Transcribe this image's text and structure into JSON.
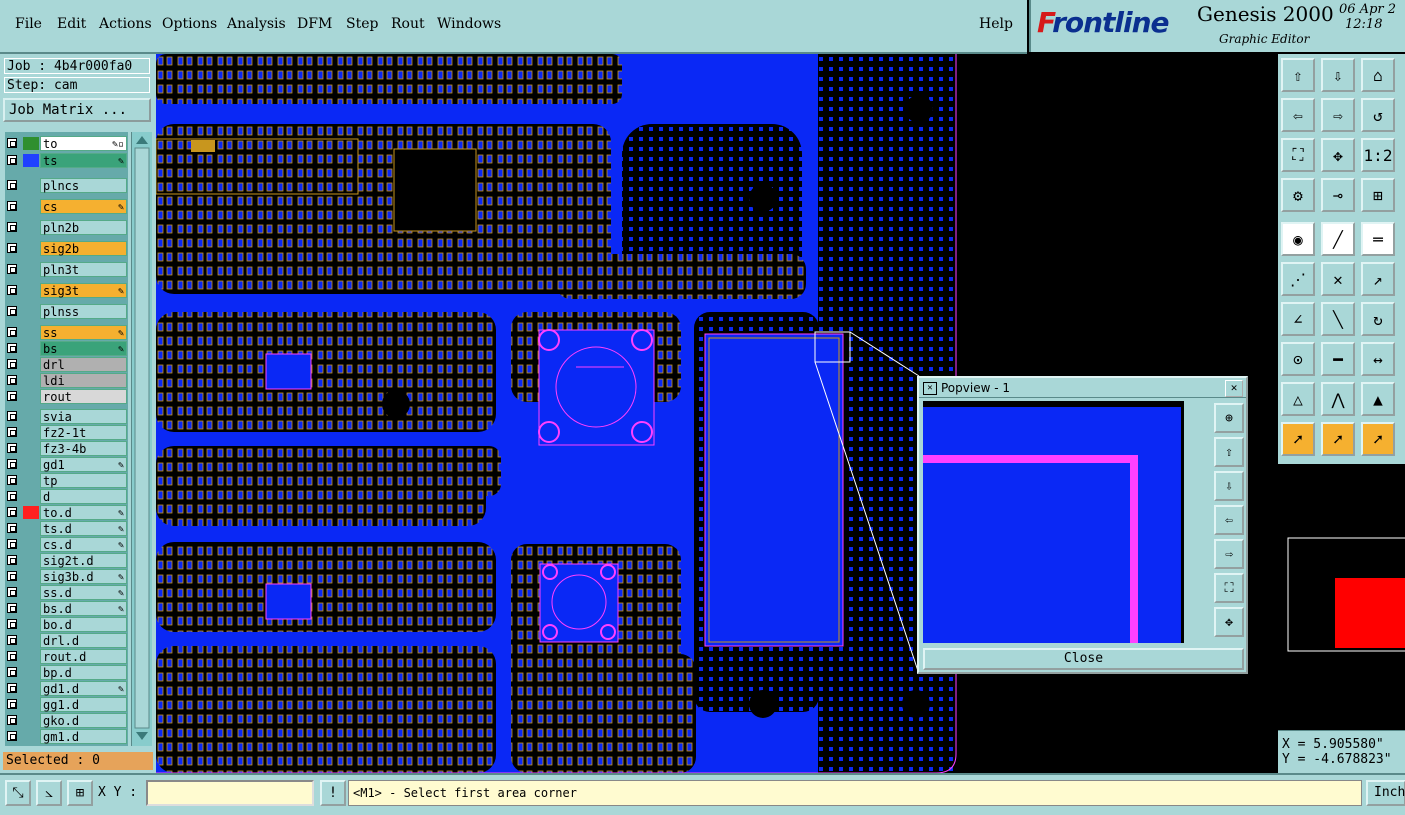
{
  "menubar": {
    "items": [
      "File",
      "Edit",
      "Actions",
      "Options",
      "Analysis",
      "DFM",
      "Step",
      "Rout",
      "Windows"
    ],
    "help": "Help"
  },
  "brand": {
    "logo": "Frontline",
    "product": "Genesis 2000",
    "subtitle": "Graphic Editor",
    "date": "06 Apr 2",
    "time": "12:18 "
  },
  "left": {
    "job": "Job : 4b4r000fa0",
    "step": "Step: cam",
    "job_matrix": "Job Matrix ...",
    "selected": "Selected : 0",
    "layers": [
      {
        "name": "to",
        "swatch": "#2f8f2f",
        "bg": "#ffffff",
        "edit": "✎▫"
      },
      {
        "name": "ts",
        "swatch": "#2040ff",
        "bg": "#3aa37a",
        "edit": "✎"
      },
      {
        "name": "plncs",
        "swatch": "",
        "bg": "#a9d7d7",
        "edit": ""
      },
      {
        "name": "cs",
        "swatch": "",
        "bg": "#f5b030",
        "edit": "✎"
      },
      {
        "name": "pln2b",
        "swatch": "",
        "bg": "#a9d7d7",
        "edit": ""
      },
      {
        "name": "sig2b",
        "swatch": "",
        "bg": "#f5b030",
        "edit": ""
      },
      {
        "name": "pln3t",
        "swatch": "",
        "bg": "#a9d7d7",
        "edit": ""
      },
      {
        "name": "sig3t",
        "swatch": "",
        "bg": "#f5b030",
        "edit": "✎"
      },
      {
        "name": "plnss",
        "swatch": "",
        "bg": "#a9d7d7",
        "edit": ""
      },
      {
        "name": "ss",
        "swatch": "",
        "bg": "#f5b030",
        "edit": "✎"
      },
      {
        "name": "bs",
        "swatch": "",
        "bg": "#3aa37a",
        "edit": "✎"
      },
      {
        "name": "drl",
        "swatch": "",
        "bg": "#b0b0b0",
        "edit": ""
      },
      {
        "name": "ldi",
        "swatch": "",
        "bg": "#b0b0b0",
        "edit": ""
      },
      {
        "name": "rout",
        "swatch": "",
        "bg": "#d8d8d8",
        "edit": ""
      },
      {
        "name": "svia",
        "swatch": "",
        "bg": "#a9d7d7",
        "edit": ""
      },
      {
        "name": "fz2-1t",
        "swatch": "",
        "bg": "#a9d7d7",
        "edit": ""
      },
      {
        "name": "fz3-4b",
        "swatch": "",
        "bg": "#a9d7d7",
        "edit": ""
      },
      {
        "name": "gd1",
        "swatch": "",
        "bg": "#a9d7d7",
        "edit": "✎"
      },
      {
        "name": "tp",
        "swatch": "",
        "bg": "#a9d7d7",
        "edit": ""
      },
      {
        "name": "d",
        "swatch": "",
        "bg": "#a9d7d7",
        "edit": ""
      },
      {
        "name": "to.d",
        "swatch": "#ff2020",
        "bg": "#a9d7d7",
        "edit": "✎"
      },
      {
        "name": "ts.d",
        "swatch": "",
        "bg": "#a9d7d7",
        "edit": "✎"
      },
      {
        "name": "cs.d",
        "swatch": "",
        "bg": "#a9d7d7",
        "edit": "✎"
      },
      {
        "name": "sig2t.d",
        "swatch": "",
        "bg": "#a9d7d7",
        "edit": ""
      },
      {
        "name": "sig3b.d",
        "swatch": "",
        "bg": "#a9d7d7",
        "edit": "✎"
      },
      {
        "name": "ss.d",
        "swatch": "",
        "bg": "#a9d7d7",
        "edit": "✎"
      },
      {
        "name": "bs.d",
        "swatch": "",
        "bg": "#a9d7d7",
        "edit": "✎"
      },
      {
        "name": "bo.d",
        "swatch": "",
        "bg": "#a9d7d7",
        "edit": ""
      },
      {
        "name": "drl.d",
        "swatch": "",
        "bg": "#a9d7d7",
        "edit": ""
      },
      {
        "name": "rout.d",
        "swatch": "",
        "bg": "#a9d7d7",
        "edit": ""
      },
      {
        "name": "bp.d",
        "swatch": "",
        "bg": "#a9d7d7",
        "edit": ""
      },
      {
        "name": "gd1.d",
        "swatch": "",
        "bg": "#a9d7d7",
        "edit": "✎"
      },
      {
        "name": "gg1.d",
        "swatch": "",
        "bg": "#a9d7d7",
        "edit": ""
      },
      {
        "name": "gko.d",
        "swatch": "",
        "bg": "#a9d7d7",
        "edit": ""
      },
      {
        "name": "gm1.d",
        "swatch": "",
        "bg": "#a9d7d7",
        "edit": ""
      }
    ]
  },
  "popview": {
    "title": "Popview - 1",
    "close": "Close"
  },
  "coords": {
    "x": "X =  5.905580\"",
    "y": "Y = -4.678823\""
  },
  "status": {
    "xy_label": "X Y :",
    "xy_value": "",
    "message": "<M1> - Select first area corner",
    "units": "Inch"
  },
  "colors": {
    "panel": "#a9d7d7",
    "copper": "#0a28f5",
    "pads": "#c8961e",
    "outline": "#ff40ff"
  }
}
